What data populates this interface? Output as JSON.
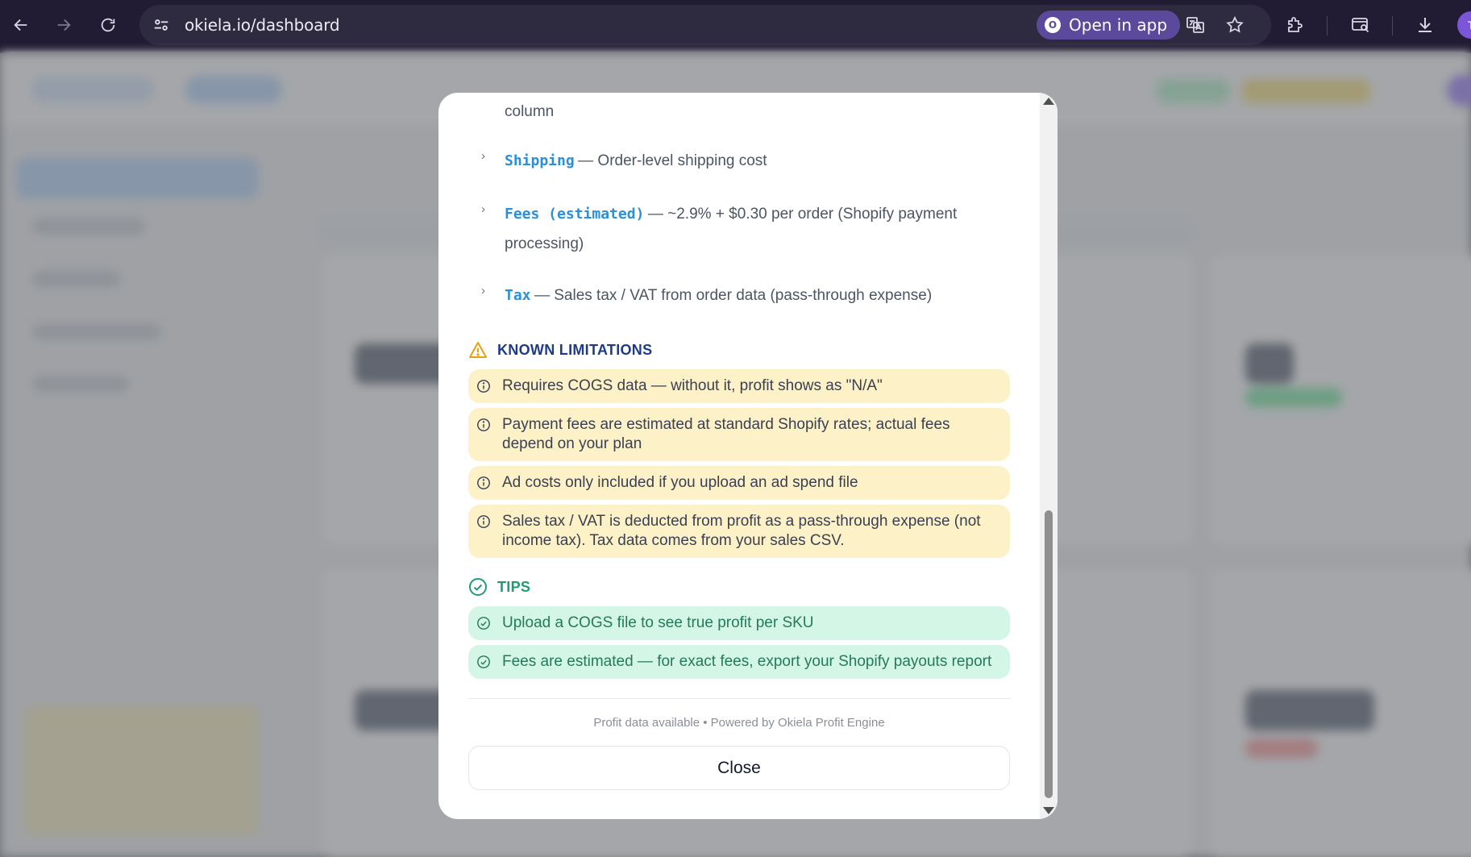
{
  "browser": {
    "url": "okiela.io/dashboard",
    "open_in_app_label": "Open in app",
    "open_in_app_badge": "O",
    "profile_initial": "T"
  },
  "modal": {
    "prev_row_tail": "column",
    "cost_items": [
      {
        "name": "Shipping",
        "description": "— Order-level shipping cost"
      },
      {
        "name": "Fees (estimated)",
        "description": "— ~2.9% + $0.30 per order (Shopify payment processing)"
      },
      {
        "name": "Tax",
        "description": "— Sales tax / VAT from order data (pass-through expense)"
      }
    ],
    "limitations": {
      "title": "KNOWN LIMITATIONS",
      "color": "#1e3a8a",
      "icon_color": "#e6a011",
      "items": [
        "Requires COGS data — without it, profit shows as \"N/A\"",
        "Payment fees are estimated at standard Shopify rates; actual fees depend on your plan",
        "Ad costs only included if you upload an ad spend file",
        "Sales tax / VAT is deducted from profit as a pass-through expense (not income tax). Tax data comes from your sales CSV."
      ]
    },
    "tips": {
      "title": "TIPS",
      "color": "#1f9d6e",
      "items": [
        "Upload a COGS file to see true profit per SKU",
        "Fees are estimated — for exact fees, export your Shopify payouts report"
      ]
    },
    "footer": "Profit data available • Powered by Okiela Profit Engine",
    "close_label": "Close"
  }
}
